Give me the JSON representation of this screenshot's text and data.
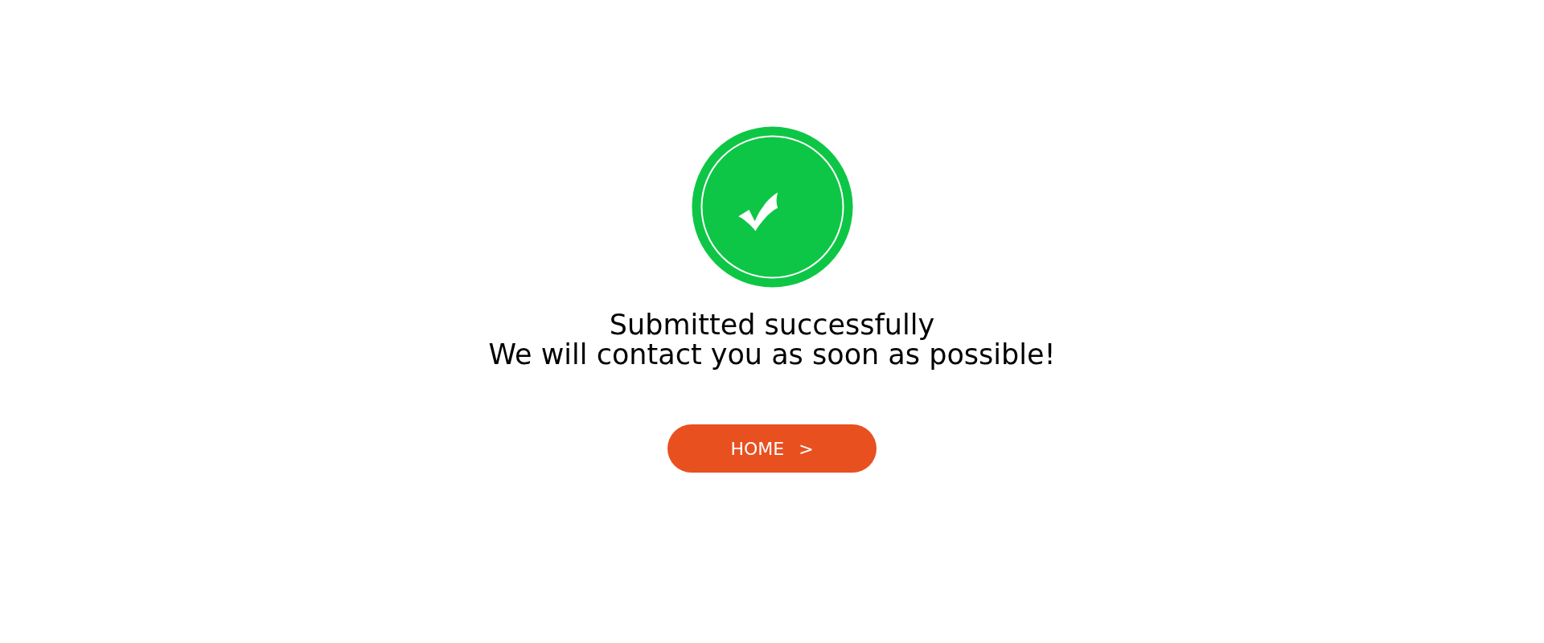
{
  "title": "Submitted successfully",
  "message": "We will contact you as soon as possible!",
  "button": {
    "label": "HOME",
    "arrow": ">"
  }
}
